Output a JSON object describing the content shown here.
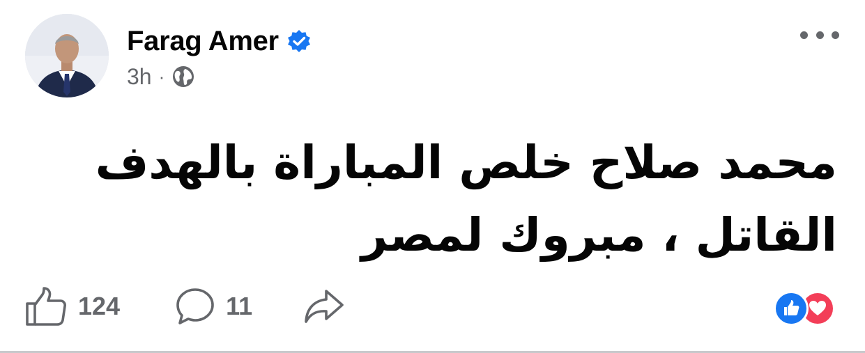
{
  "post": {
    "author_name": "Farag Amer",
    "time": "3h",
    "separator": "·",
    "audience_icon": "globe-icon",
    "verified_icon": "verified-badge-icon",
    "text": "محمد صلاح خلص المباراة بالهدف\nالقاتل ، مبروك لمصر"
  },
  "actions": {
    "like_count": "124",
    "comment_count": "11",
    "share_icon": "share-icon"
  },
  "reactions": [
    "like",
    "love"
  ],
  "colors": {
    "brand_blue": "#1877F2",
    "love_red": "#F33E58",
    "text_primary": "#050505",
    "text_secondary": "#65676B"
  }
}
